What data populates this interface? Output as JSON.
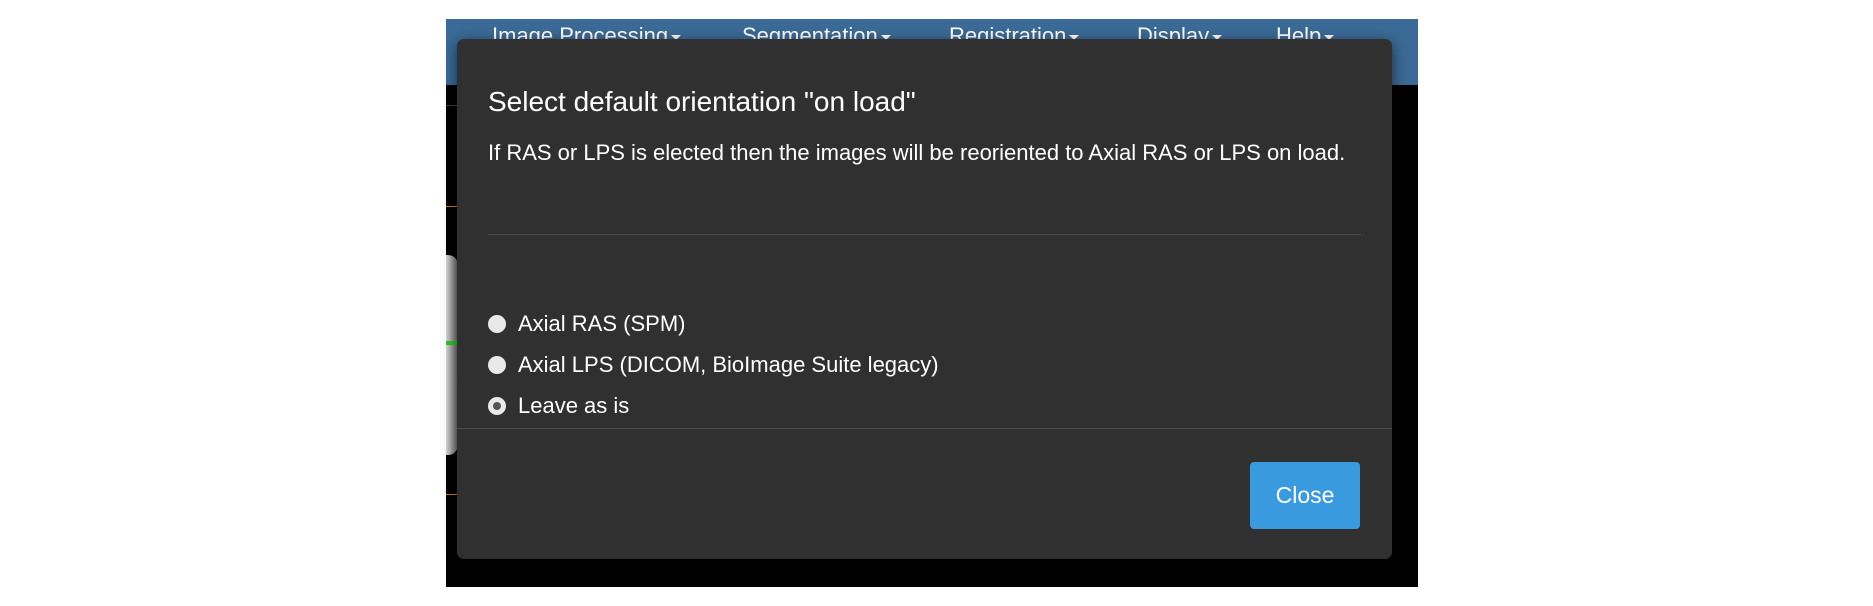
{
  "menubar": {
    "items": [
      {
        "label": "Image Processing"
      },
      {
        "label": "Segmentation"
      },
      {
        "label": "Registration"
      },
      {
        "label": "Display"
      },
      {
        "label": "Help"
      }
    ]
  },
  "modal": {
    "title": "Select default orientation \"on load\"",
    "description": "If RAS or LPS is elected then the images will be reoriented to Axial RAS or LPS on load.",
    "options": [
      {
        "label": "Axial RAS (SPM)",
        "checked": false
      },
      {
        "label": "Axial LPS (DICOM, BioImage Suite legacy)",
        "checked": false
      },
      {
        "label": "Leave as is",
        "checked": true
      }
    ],
    "close_label": "Close"
  },
  "colors": {
    "menubar": "#3b6a96",
    "modal_bg": "#303030",
    "accent_button": "#3a9ae0"
  }
}
